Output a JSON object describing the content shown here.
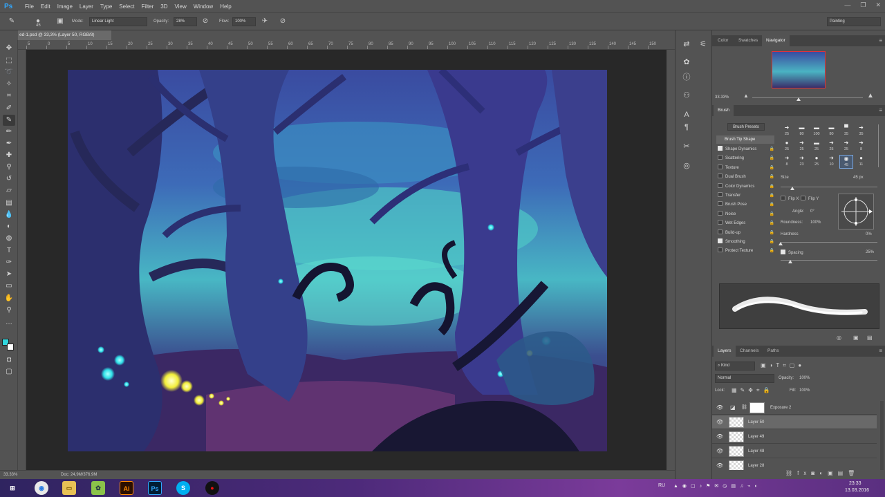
{
  "app": {
    "logo": "Ps"
  },
  "menu": [
    "File",
    "Edit",
    "Image",
    "Layer",
    "Type",
    "Select",
    "Filter",
    "3D",
    "View",
    "Window",
    "Help"
  ],
  "options": {
    "brush_size": "45",
    "mode_label": "Mode:",
    "mode_value": "Linear Light",
    "opacity_label": "Opacity:",
    "opacity_value": "28%",
    "flow_label": "Flow:",
    "flow_value": "100%",
    "workspace": "Painting"
  },
  "document": {
    "tab_title": "ed-1.psd @ 33,3% (Layer 50, RGB/8)"
  },
  "ruler": {
    "top_labels": [
      "5",
      "0",
      "5",
      "10",
      "15",
      "20",
      "25",
      "30",
      "35",
      "40",
      "45",
      "50",
      "55",
      "60",
      "65",
      "70",
      "75",
      "80",
      "85",
      "90",
      "95",
      "100",
      "105",
      "110",
      "115",
      "120",
      "125",
      "130",
      "135",
      "140",
      "145",
      "150"
    ]
  },
  "status": {
    "zoom": "33.33%",
    "doc": "Doc: 24,9M/376,9M"
  },
  "navigator": {
    "tabs": [
      "Color",
      "Swatches",
      "Navigator"
    ],
    "zoom": "33.33%"
  },
  "brush_panel": {
    "title": "Brush",
    "presets_button": "Brush Presets",
    "tip_shape": "Brush Tip Shape",
    "options": [
      {
        "label": "Shape Dynamics",
        "checked": true
      },
      {
        "label": "Scattering",
        "checked": false
      },
      {
        "label": "Texture",
        "checked": false
      },
      {
        "label": "Dual Brush",
        "checked": false
      },
      {
        "label": "Color Dynamics",
        "checked": false
      },
      {
        "label": "Transfer",
        "checked": false
      },
      {
        "label": "Brush Pose",
        "checked": false
      },
      {
        "label": "Noise",
        "checked": false
      },
      {
        "label": "Wet Edges",
        "checked": false
      },
      {
        "label": "Build-up",
        "checked": false
      },
      {
        "label": "Smoothing",
        "checked": true
      },
      {
        "label": "Protect Texture",
        "checked": false
      }
    ],
    "preset_sizes": [
      "25",
      "80",
      "100",
      "80",
      "35",
      "35",
      "25",
      "25",
      "25",
      "25",
      "25",
      "8",
      "8",
      "23",
      "25",
      "10",
      "45",
      "11"
    ],
    "size_label": "Size",
    "size_value": "45 px",
    "flip_x": "Flip X",
    "flip_y": "Flip Y",
    "angle_label": "Angle:",
    "angle_value": "0°",
    "roundness_label": "Roundness:",
    "roundness_value": "100%",
    "hardness_label": "Hardness",
    "hardness_value": "0%",
    "spacing_label": "Spacing",
    "spacing_value": "25%",
    "size_fraction": 0.12,
    "hardness_fraction": 0.0,
    "spacing_fraction": 0.1
  },
  "layers_panel": {
    "tabs": [
      "Layers",
      "Channels",
      "Paths"
    ],
    "filter": "Kind",
    "blend": "Normal",
    "opacity_label": "Opacity:",
    "opacity_value": "100%",
    "lock_label": "Lock:",
    "fill_label": "Fill:",
    "fill_value": "100%",
    "layers": [
      {
        "name": "Exposure 2",
        "selected": false
      },
      {
        "name": "Layer 50",
        "selected": true
      },
      {
        "name": "Layer 49",
        "selected": false
      },
      {
        "name": "Layer 48",
        "selected": false
      },
      {
        "name": "Layer 28",
        "selected": false
      }
    ]
  },
  "taskbar": {
    "lang": "RU",
    "time": "23:33",
    "date": "13.03.2016",
    "apps": [
      "Chrome",
      "Explorer",
      "Green",
      "Ai",
      "Ps",
      "Skype",
      "Rec"
    ]
  },
  "colors": {
    "foreground": "#31d7df",
    "background": "#ffffff",
    "accent": "#31a8ff",
    "navigator_frame": "#e0323a"
  }
}
